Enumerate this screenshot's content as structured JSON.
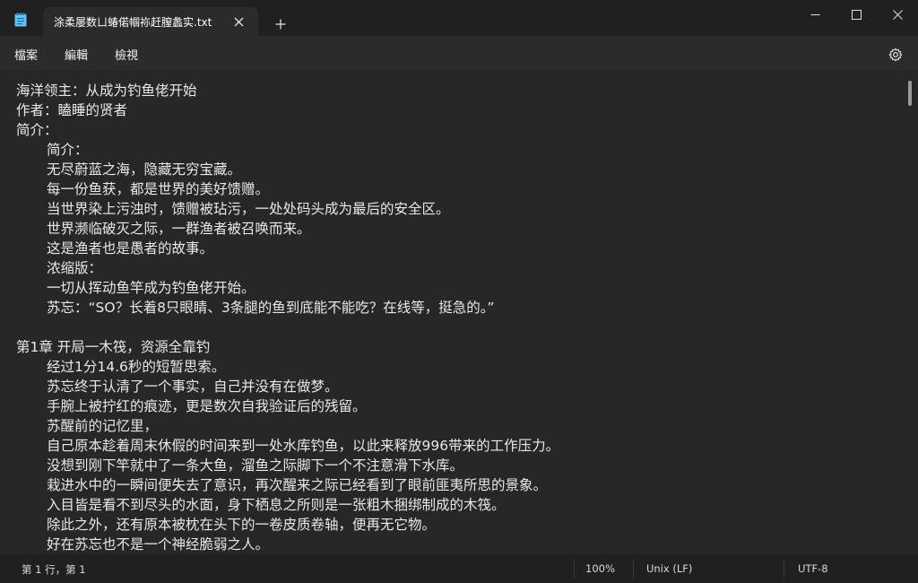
{
  "window": {
    "tab_title": "涂柔屡数ㄩ蝽偌帼袮赶膣蠡实.txt",
    "new_tab_symbol": "+",
    "close_tab_symbol": "✕"
  },
  "menu": {
    "file": "檔案",
    "edit": "編輯",
    "view": "檢視"
  },
  "document": {
    "lines": [
      {
        "text": "海洋领主：从成为钓鱼佬开始",
        "indent": false
      },
      {
        "text": "作者：瞌睡的贤者",
        "indent": false
      },
      {
        "text": "简介：",
        "indent": false
      },
      {
        "text": "简介：",
        "indent": true
      },
      {
        "text": "无尽蔚蓝之海，隐藏无穷宝藏。",
        "indent": true
      },
      {
        "text": "每一份鱼获，都是世界的美好馈赠。",
        "indent": true
      },
      {
        "text": "当世界染上污浊时，馈赠被玷污，一处处码头成为最后的安全区。",
        "indent": true
      },
      {
        "text": "世界濒临破灭之际，一群渔者被召唤而来。",
        "indent": true
      },
      {
        "text": "这是渔者也是愚者的故事。",
        "indent": true
      },
      {
        "text": "浓缩版：",
        "indent": true
      },
      {
        "text": "一切从挥动鱼竿成为钓鱼佬开始。",
        "indent": true
      },
      {
        "text": "苏忘：“SO？长着8只眼睛、3条腿的鱼到底能不能吃？在线等，挺急的。”",
        "indent": true
      },
      {
        "text": "",
        "indent": false
      },
      {
        "text": "第1章 开局一木筏，资源全靠钓",
        "indent": false
      },
      {
        "text": "经过1分14.6秒的短暂思索。",
        "indent": true
      },
      {
        "text": "苏忘终于认清了一个事实，自己并没有在做梦。",
        "indent": true
      },
      {
        "text": "手腕上被拧红的痕迹，更是数次自我验证后的残留。",
        "indent": true
      },
      {
        "text": "苏醒前的记忆里，",
        "indent": true
      },
      {
        "text": "自己原本趁着周末休假的时间来到一处水库钓鱼，以此来释放996带来的工作压力。",
        "indent": true
      },
      {
        "text": "没想到刚下竿就中了一条大鱼，溜鱼之际脚下一个不注意滑下水库。",
        "indent": true
      },
      {
        "text": "栽进水中的一瞬间便失去了意识，再次醒来之际已经看到了眼前匪夷所思的景象。",
        "indent": true
      },
      {
        "text": "入目皆是看不到尽头的水面，身下栖息之所则是一张粗木捆绑制成的木筏。",
        "indent": true
      },
      {
        "text": "除此之外，还有原本被枕在头下的一卷皮质卷轴，便再无它物。",
        "indent": true
      },
      {
        "text": "好在苏忘也不是一个神经脆弱之人。",
        "indent": true
      }
    ]
  },
  "status": {
    "position": "第 1 行，第 1",
    "zoom": "100%",
    "line_ending": "Unix (LF)",
    "encoding": "UTF-8"
  },
  "icons": {
    "app": "notepad-icon",
    "close": "close-icon",
    "add": "plus-icon",
    "minimize": "minimize-icon",
    "maximize": "maximize-icon",
    "settings": "gear-icon"
  },
  "colors": {
    "titlebar": "#202020",
    "editor_bg": "#272727",
    "text": "#e8e8e8"
  }
}
